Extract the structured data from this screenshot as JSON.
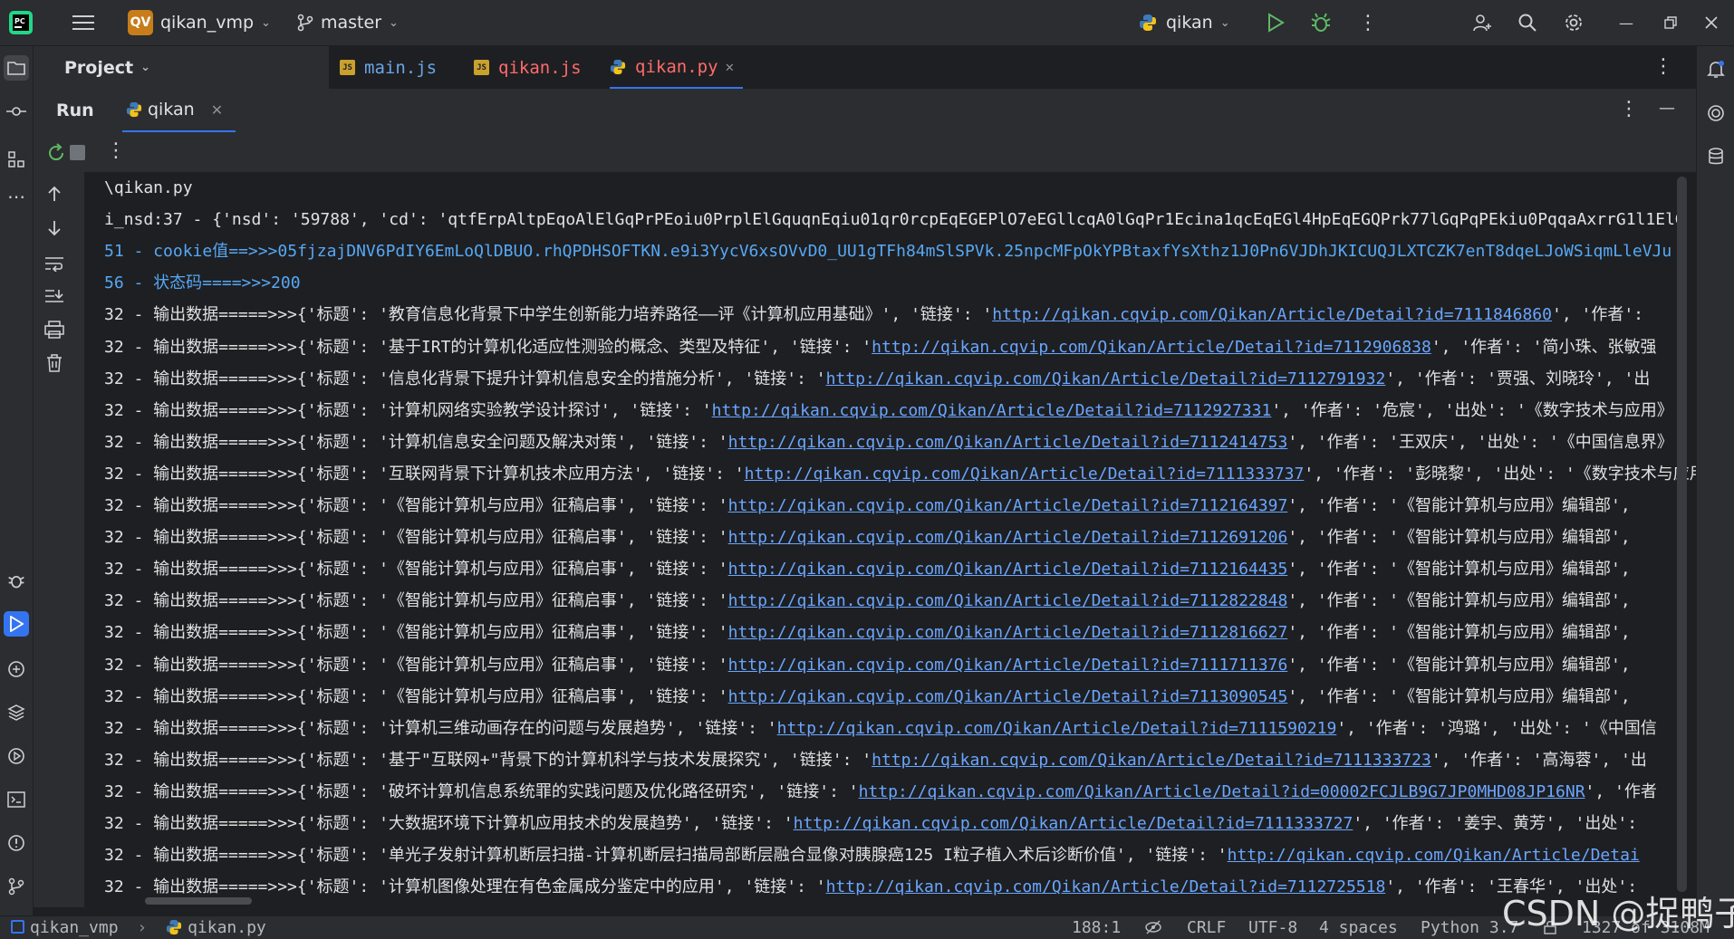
{
  "topbar": {
    "project_badge": "QV",
    "project_name": "qikan_vmp",
    "branch": "master",
    "run_config": "qikan"
  },
  "project_panel": {
    "label": "Project"
  },
  "editor_tabs": [
    {
      "label": "main.js",
      "type": "js"
    },
    {
      "label": "qikan.js",
      "type": "js"
    },
    {
      "label": "qikan.py",
      "type": "py",
      "active": true
    }
  ],
  "run_panel": {
    "title": "Run",
    "tab_label": "qikan"
  },
  "console": {
    "lines": [
      {
        "kind": "plain",
        "text": "\\qikan.py"
      },
      {
        "kind": "plain",
        "text": "i_nsd:37 - {'nsd': '59788', 'cd': 'qtfErpAltpEqoAlElGqPrPEoiu0PrplElGquqnEqiu01qr0rcpEqEGEPlO7eEGllcqA0lGqPr1Ecina1qcEqEGl4HpEqEGQPrk77lGqPqPEkiu0PqqaAxrrG1l1ElG"
      },
      {
        "kind": "blue",
        "text": "51 - cookie值==>>>05fjzajDNV6PdIY6EmLoQlDBUO.rhQPDHSOFTKN.e9i3YycV6xsOVvD0_UU1gTFh84mSlSPVk.25npcMFpOkYPBtaxfYsXthz1J0Pn6VJDhJKICUQJLXTCZK7enT8dqeLJoWSiqmLleVJu"
      },
      {
        "kind": "blue",
        "text": "56 - 状态码====>>>200"
      },
      {
        "kind": "rec",
        "pre": "32 - 输出数据=====>>>{'标题': '教育信息化背景下中学生创新能力培养路径——评《计算机应用基础》', '链接': '",
        "url": "http://qikan.cqvip.com/Qikan/Article/Detail?id=7111846860",
        "post": "', '作者':"
      },
      {
        "kind": "rec",
        "pre": "32 - 输出数据=====>>>{'标题': '基于IRT的计算机化适应性测验的概念、类型及特征', '链接': '",
        "url": "http://qikan.cqvip.com/Qikan/Article/Detail?id=7112906838",
        "post": "', '作者': '简小珠、张敏强"
      },
      {
        "kind": "rec",
        "pre": "32 - 输出数据=====>>>{'标题': '信息化背景下提升计算机信息安全的措施分析', '链接': '",
        "url": "http://qikan.cqvip.com/Qikan/Article/Detail?id=7112791932",
        "post": "', '作者': '贾强、刘晓玲', '出"
      },
      {
        "kind": "rec",
        "pre": "32 - 输出数据=====>>>{'标题': '计算机网络实验教学设计探讨', '链接': '",
        "url": "http://qikan.cqvip.com/Qikan/Article/Detail?id=7112927331",
        "post": "', '作者': '危宸', '出处': '《数字技术与应用》"
      },
      {
        "kind": "rec",
        "pre": "32 - 输出数据=====>>>{'标题': '计算机信息安全问题及解决对策', '链接': '",
        "url": "http://qikan.cqvip.com/Qikan/Article/Detail?id=7112414753",
        "post": "', '作者': '王双庆', '出处': '《中国信息界》"
      },
      {
        "kind": "rec",
        "pre": "32 - 输出数据=====>>>{'标题': '互联网背景下计算机技术应用方法', '链接': '",
        "url": "http://qikan.cqvip.com/Qikan/Article/Detail?id=7111333737",
        "post": "', '作者': '彭晓黎', '出处': '《数字技术与应用》"
      },
      {
        "kind": "rec",
        "pre": "32 - 输出数据=====>>>{'标题': '《智能计算机与应用》征稿启事', '链接': '",
        "url": "http://qikan.cqvip.com/Qikan/Article/Detail?id=7112164397",
        "post": "', '作者': '《智能计算机与应用》编辑部',"
      },
      {
        "kind": "rec",
        "pre": "32 - 输出数据=====>>>{'标题': '《智能计算机与应用》征稿启事', '链接': '",
        "url": "http://qikan.cqvip.com/Qikan/Article/Detail?id=7112691206",
        "post": "', '作者': '《智能计算机与应用》编辑部',"
      },
      {
        "kind": "rec",
        "pre": "32 - 输出数据=====>>>{'标题': '《智能计算机与应用》征稿启事', '链接': '",
        "url": "http://qikan.cqvip.com/Qikan/Article/Detail?id=7112164435",
        "post": "', '作者': '《智能计算机与应用》编辑部',"
      },
      {
        "kind": "rec",
        "pre": "32 - 输出数据=====>>>{'标题': '《智能计算机与应用》征稿启事', '链接': '",
        "url": "http://qikan.cqvip.com/Qikan/Article/Detail?id=7112822848",
        "post": "', '作者': '《智能计算机与应用》编辑部',"
      },
      {
        "kind": "rec",
        "pre": "32 - 输出数据=====>>>{'标题': '《智能计算机与应用》征稿启事', '链接': '",
        "url": "http://qikan.cqvip.com/Qikan/Article/Detail?id=7112816627",
        "post": "', '作者': '《智能计算机与应用》编辑部',"
      },
      {
        "kind": "rec",
        "pre": "32 - 输出数据=====>>>{'标题': '《智能计算机与应用》征稿启事', '链接': '",
        "url": "http://qikan.cqvip.com/Qikan/Article/Detail?id=7111711376",
        "post": "', '作者': '《智能计算机与应用》编辑部',"
      },
      {
        "kind": "rec",
        "pre": "32 - 输出数据=====>>>{'标题': '《智能计算机与应用》征稿启事', '链接': '",
        "url": "http://qikan.cqvip.com/Qikan/Article/Detail?id=7113090545",
        "post": "', '作者': '《智能计算机与应用》编辑部',"
      },
      {
        "kind": "rec",
        "pre": "32 - 输出数据=====>>>{'标题': '计算机三维动画存在的问题与发展趋势', '链接': '",
        "url": "http://qikan.cqvip.com/Qikan/Article/Detail?id=7111590219",
        "post": "', '作者': '鸿璐', '出处': '《中国信"
      },
      {
        "kind": "rec",
        "pre": "32 - 输出数据=====>>>{'标题': '基于\"互联网+\"背景下的计算机科学与技术发展探究', '链接': '",
        "url": "http://qikan.cqvip.com/Qikan/Article/Detail?id=7111333723",
        "post": "', '作者': '高海蓉', '出"
      },
      {
        "kind": "rec",
        "pre": "32 - 输出数据=====>>>{'标题': '破坏计算机信息系统罪的实践问题及优化路径研究', '链接': '",
        "url": "http://qikan.cqvip.com/Qikan/Article/Detail?id=00002FCJLB9G7JP0MHD08JP16NR",
        "post": "', '作者"
      },
      {
        "kind": "rec",
        "pre": "32 - 输出数据=====>>>{'标题': '大数据环境下计算机应用技术的发展趋势', '链接': '",
        "url": "http://qikan.cqvip.com/Qikan/Article/Detail?id=7111333727",
        "post": "', '作者': '姜宇、黄芳', '出处':"
      },
      {
        "kind": "rec",
        "pre": "32 - 输出数据=====>>>{'标题': '单光子发射计算机断层扫描-计算机断层扫描局部断层融合显像对胰腺癌125 I粒子植入术后诊断价值', '链接': '",
        "url": "http://qikan.cqvip.com/Qikan/Article/Detai",
        "post": ""
      },
      {
        "kind": "rec",
        "pre": "32 - 输出数据=====>>>{'标题': '计算机图像处理在有色金属成分鉴定中的应用', '链接': '",
        "url": "http://qikan.cqvip.com/Qikan/Article/Detail?id=7112725518",
        "post": "', '作者': '王春华', '出处':"
      }
    ]
  },
  "statusbar": {
    "breadcrumb_project": "qikan_vmp",
    "breadcrumb_file": "qikan.py",
    "position": "188:1",
    "line_ending": "CRLF",
    "encoding": "UTF-8",
    "indent": "4 spaces",
    "interpreter": "Python 3.7",
    "memory": "1327 of 3108M"
  },
  "watermark": "CSDN @捉鸭子",
  "colors": {
    "background": "#1e1f22",
    "panel": "#2b2d30",
    "accent": "#3574f0",
    "link": "#6aa6ff",
    "log_blue": "#56a8f5",
    "tab_active_text": "#ff6b6b"
  }
}
